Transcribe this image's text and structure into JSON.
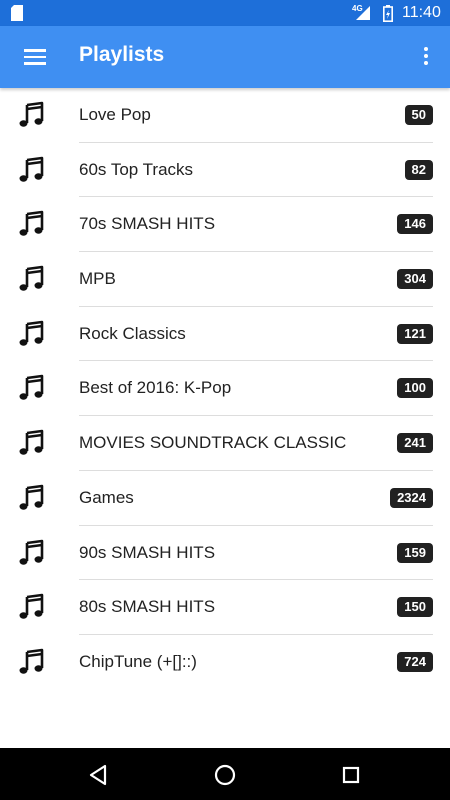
{
  "status_bar": {
    "network": "4G",
    "time": "11:40"
  },
  "app_bar": {
    "title": "Playlists"
  },
  "playlists": [
    {
      "name": "Love Pop",
      "count": "50"
    },
    {
      "name": "60s Top Tracks",
      "count": "82"
    },
    {
      "name": "70s SMASH HITS",
      "count": "146"
    },
    {
      "name": "MPB",
      "count": "304"
    },
    {
      "name": "Rock Classics",
      "count": "121"
    },
    {
      "name": "Best of 2016: K-Pop",
      "count": "100"
    },
    {
      "name": "MOVIES SOUNDTRACK CLASSIC",
      "count": "241"
    },
    {
      "name": "Games",
      "count": "2324"
    },
    {
      "name": "90s SMASH HITS",
      "count": "159"
    },
    {
      "name": "80s SMASH HITS",
      "count": "150"
    },
    {
      "name": "ChipTune (+[]::)",
      "count": "724"
    }
  ],
  "icons": {
    "menu": "hamburger-menu-icon",
    "overflow": "more-vert-icon",
    "playlist": "music-note-icon",
    "back": "back-triangle-icon",
    "home": "home-circle-icon",
    "recents": "recents-square-icon"
  },
  "colors": {
    "status_bar": "#1e6fd9",
    "app_bar": "#3f8ff2",
    "badge": "#212121"
  }
}
